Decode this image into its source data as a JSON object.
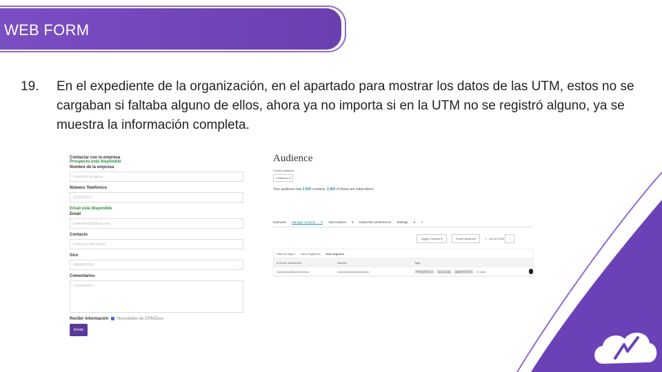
{
  "slide": {
    "title": "WEB FORM",
    "item_number": "19.",
    "paragraph": "En el expediente de la organización, en el apartado para mostrar los datos de las UTM, estos no se cargaban si faltaba alguno de ellos, ahora ya no importa si en la UTM no se registró alguno, ya se muestra la información completa."
  },
  "form": {
    "contact_company": "Contactar con la empresa",
    "prospect_available": "Prospecto está disponible",
    "company_label": "Nombre de la empresa",
    "company_placeholder": "Ferretería la laguna",
    "phone_label": "Número Telefónico",
    "phone_placeholder": "3315315311",
    "email_available": "Email está disponible",
    "email_label": "Email",
    "email_placeholder": "lcebrnabos@alpura.com",
    "contact_label": "Contacto",
    "contact_placeholder": "Francisco Hernández",
    "giro_label": "Giro",
    "giro_value": "ABARROTES",
    "comments_label": "Comentarios",
    "comments_placeholder": "Comentarios...",
    "receive_label": "Recibir información",
    "newsletter_label": "Novedades de CRMZeus",
    "submit_label": "Enviar"
  },
  "audience": {
    "title": "Audience",
    "current_label": "Current audience",
    "current_value": "CRMZeus",
    "summary_prefix": "Your audience has",
    "contacts_count": "2,959",
    "summary_mid": "contacts.",
    "subscribers_count": "2,955",
    "summary_suffix": "of these are subscribers.",
    "tabs": [
      "Overview",
      "Manage contacts",
      "Add contacts",
      "Subscriber preferences",
      "Settings"
    ],
    "toggle_columns": "Toggle Columns",
    "export_audience": "Export Audience",
    "pagination": "1 - 100 of 2,520",
    "filters": [
      "Filter by Tags",
      "View Segment",
      "New Segment"
    ],
    "columns": [
      "Correo electrónico",
      "Nombre",
      "Tags"
    ],
    "row": {
      "email": "xxxxxxxxxx@xxxxx.xxxxxx",
      "name": "xxxxxxxxxxxxxxxxxxxxxxx",
      "tags": [
        "PROSPECTO",
        "sin cliente",
        "ABARROTES"
      ],
      "more": "+2 more"
    }
  }
}
